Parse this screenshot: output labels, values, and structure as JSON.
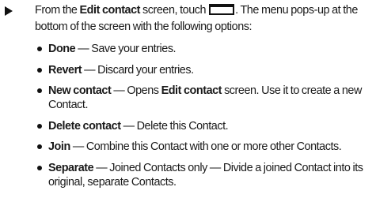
{
  "intro": {
    "lead": "From the ",
    "screen_name": "Edit contact",
    "mid": " screen, touch ",
    "menu_key_icon": "menu-key-icon",
    "tail": ". The menu pops-up at the bottom of the screen with the following options:"
  },
  "options": [
    {
      "term": "Done",
      "desc": " — Save your entries."
    },
    {
      "term": "Revert",
      "desc": " — Discard your entries."
    },
    {
      "term": "New contact",
      "desc_pre": " — Opens ",
      "desc_bold": "Edit contact",
      "desc_post": " screen. Use it to create a new Contact."
    },
    {
      "term": "Delete contact",
      "desc": " — Delete this Contact."
    },
    {
      "term": "Join",
      "desc": " — Combine this Contact with one or more other Contacts."
    },
    {
      "term": "Separate",
      "desc": " — Joined Contacts only — Divide a joined Contact into its original, separate Contacts."
    }
  ]
}
